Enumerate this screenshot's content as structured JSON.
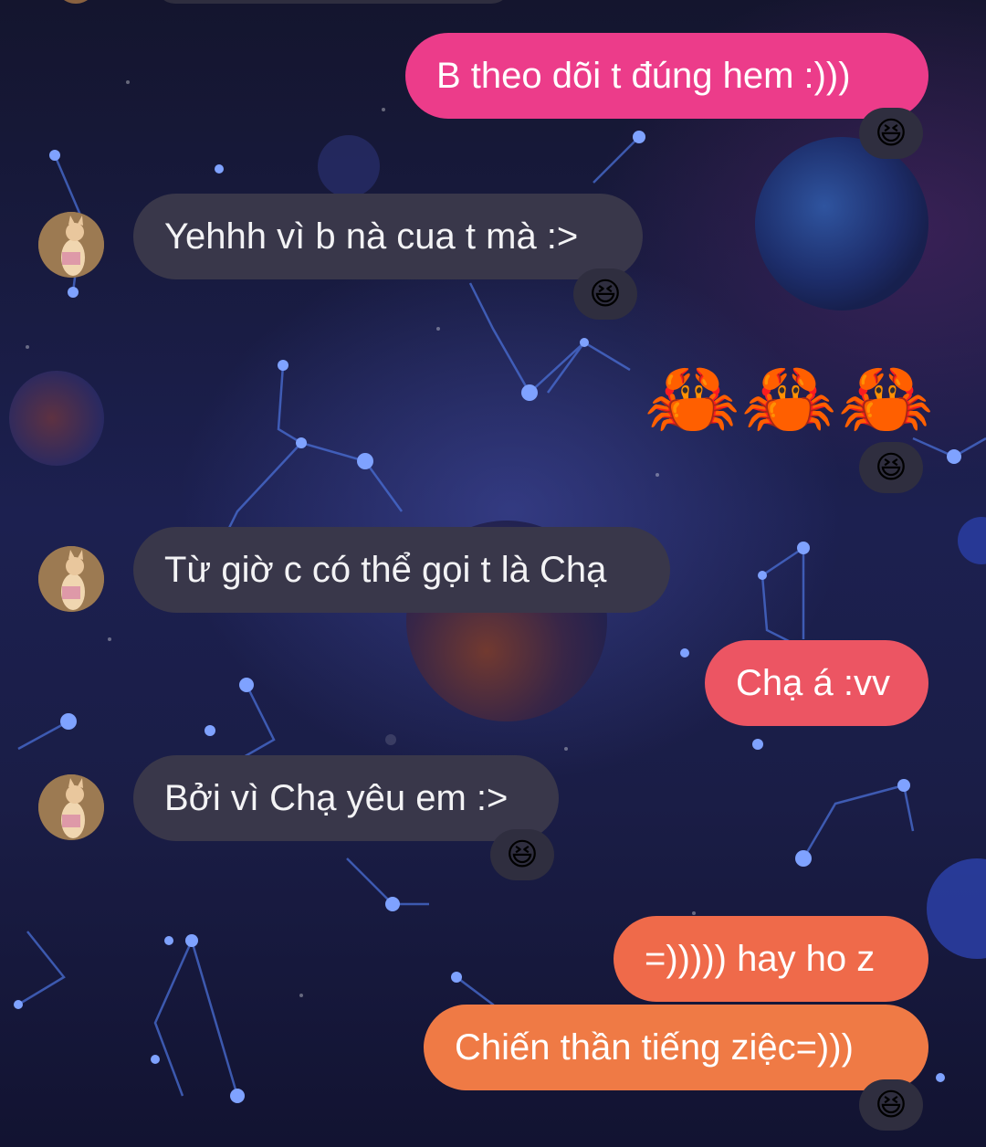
{
  "messages": [
    {
      "id": "m1",
      "from": "me",
      "text": "B theo dõi t đúng hem :)))",
      "reaction": "😆",
      "color": "#ec3c8a"
    },
    {
      "id": "m2",
      "from": "them",
      "text": "Yehhh vì b nà cua t mà :>",
      "reaction": "😆"
    },
    {
      "id": "m3",
      "from": "me",
      "emojis": [
        "🦀",
        "🦀",
        "🦀"
      ],
      "reaction": "😆"
    },
    {
      "id": "m4",
      "from": "them",
      "text": "Từ giờ c có thể gọi t là Chạ"
    },
    {
      "id": "m5",
      "from": "me",
      "text": "Chạ á :vv",
      "color": "#ec5563"
    },
    {
      "id": "m6",
      "from": "them",
      "text": "Bởi vì Chạ yêu em :>",
      "reaction": "😆"
    },
    {
      "id": "m7",
      "from": "me",
      "text": "=))))) hay ho z",
      "color": "#ef6a4a"
    },
    {
      "id": "m8",
      "from": "me",
      "text": "Chiến thần tiếng ziệc=)))",
      "reaction": "😆",
      "color": "#ef7a45"
    }
  ],
  "icons": {
    "avatar": "cat-avatar-icon",
    "reaction": "laughing-face-icon",
    "crab": "crab-emoji-icon"
  },
  "theme": {
    "incoming_bubble": "#39374a",
    "reaction_pill": "#2f2e3f",
    "background": "#1a1d46"
  }
}
